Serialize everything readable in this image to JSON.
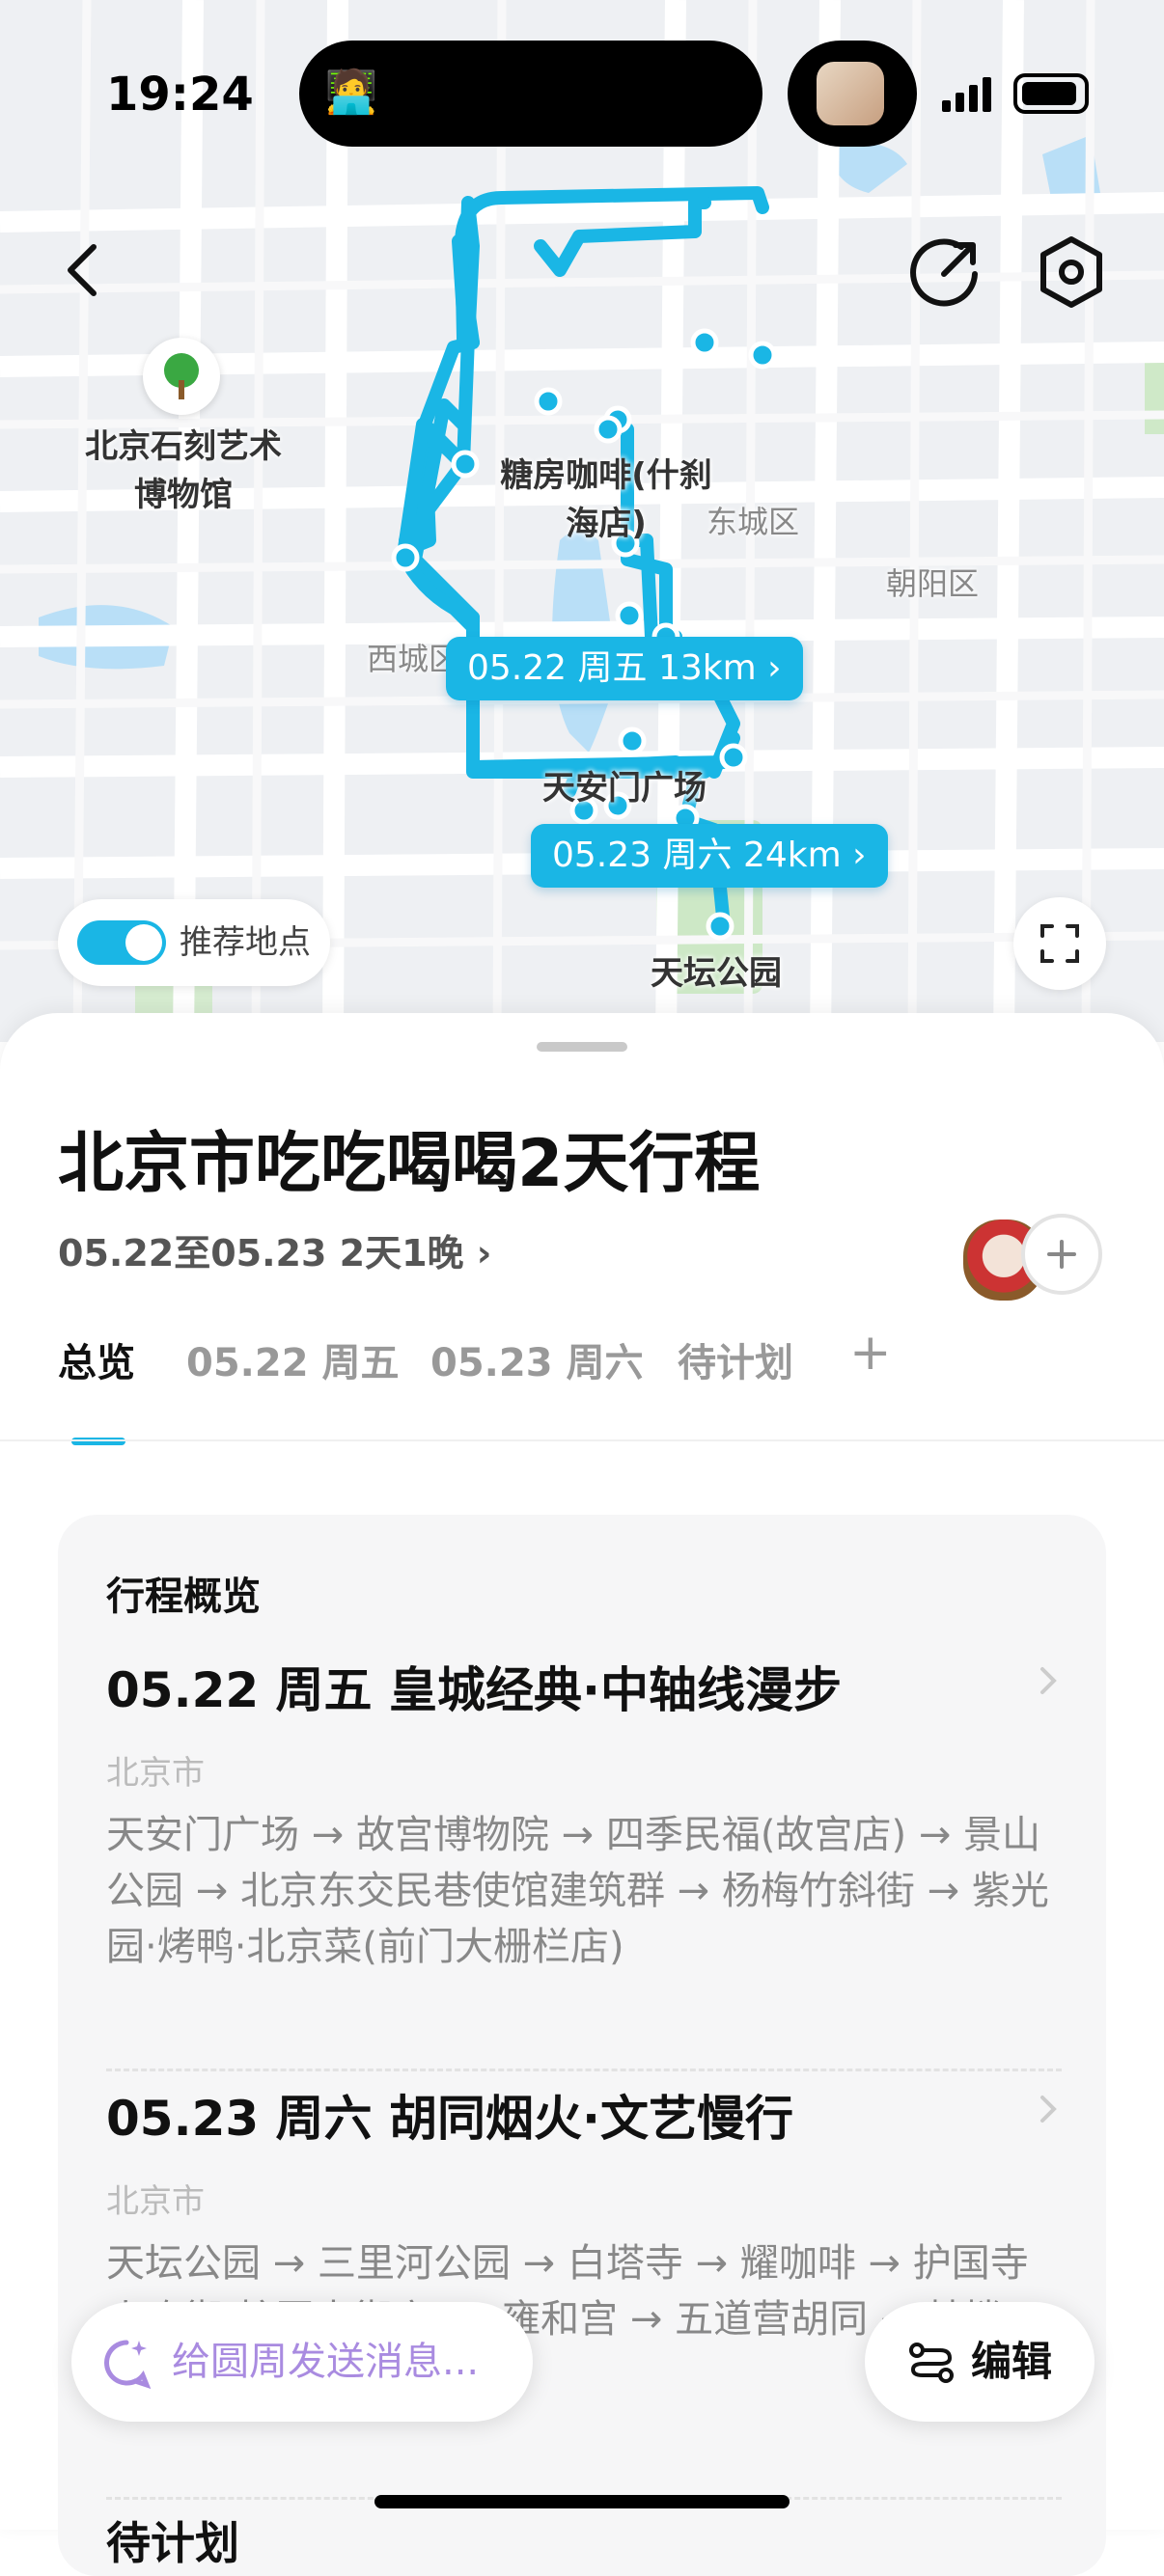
{
  "status_bar": {
    "time": "19:24",
    "island_emoji": "🧑‍💻"
  },
  "map": {
    "labels": {
      "museum": "北京石刻艺术\n博物馆",
      "cafe": "糖房咖啡(什刹\n海店)",
      "dongcheng": "东城区",
      "chaoyang": "朝阳区",
      "xicheng": "西城区",
      "tiananmen": "天安门广场",
      "temple_of_heaven": "天坛公园"
    },
    "day_chips": [
      {
        "label": "05.22 周五 13km ›"
      },
      {
        "label": "05.23 周六 24km ›"
      }
    ],
    "recommend_toggle_label": "推荐地点",
    "recommend_toggle_on": true,
    "route_color": "#1ab6e5",
    "icons": {
      "back": "back-arrow-icon",
      "share": "share-icon",
      "settings": "settings-icon",
      "expand": "expand-icon",
      "poi": "tree-icon"
    }
  },
  "trip": {
    "title": "北京市吃吃喝喝2天行程",
    "date_range": "05.22至05.23 2天1晚 ›"
  },
  "tabs": [
    {
      "label": "总览",
      "active": true
    },
    {
      "label": "05.22 周五",
      "active": false
    },
    {
      "label": "05.23 周六",
      "active": false
    },
    {
      "label": "待计划",
      "active": false
    },
    {
      "label": "+",
      "active": false
    }
  ],
  "overview": {
    "header": "行程概览",
    "days": [
      {
        "title": "05.22 周五  皇城经典·中轴线漫步",
        "city": "北京市",
        "route": "天安门广场 → 故宫博物院 → 四季民福(故宫店) → 景山公园 → 北京东交民巷使馆建筑群 → 杨梅竹斜街 → 紫光园·烤鸭·北京菜(前门大栅栏店)"
      },
      {
        "title": "05.23 周六  胡同烟火·文艺慢行",
        "city": "北京市",
        "route": "天坛公园 → 三里河公园 → 白塔寺 → 耀咖啡 → 护国寺小吃街(护国寺街店) → 雍和宫 → 五道营胡同 → 鼓楼 → (什刹海店)"
      }
    ],
    "footer_title": "待计划"
  },
  "bottom": {
    "message_placeholder": "给圆周发送消息...",
    "edit_label": "编辑"
  },
  "accent_color": "#1ab6e5"
}
